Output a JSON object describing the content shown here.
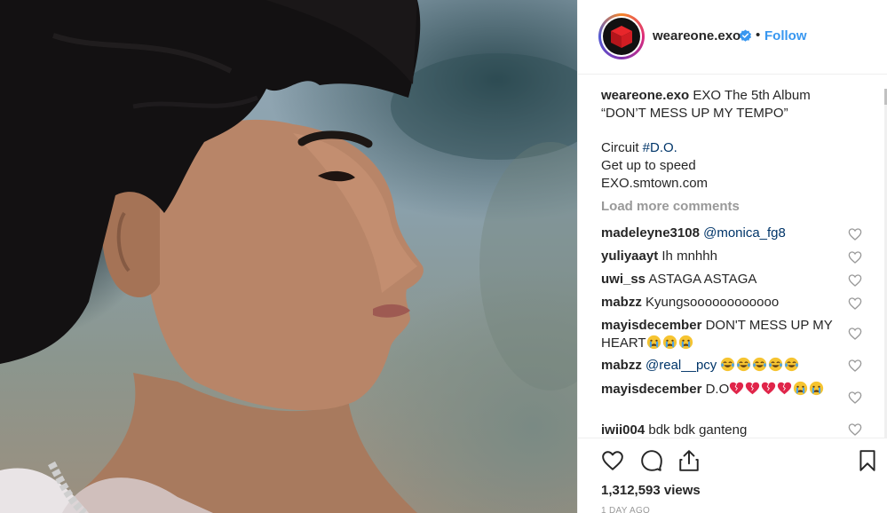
{
  "post": {
    "username": "weareone.exo",
    "follow_label": "Follow",
    "separator": "•",
    "caption": {
      "username": "weareone.exo",
      "line1": "EXO The 5th Album",
      "line2": "“DON’T MESS UP MY TEMPO”",
      "line3_prefix": "Circuit ",
      "line3_tag": "#D.O.",
      "line4": "Get up to speed",
      "line5": "EXO.smtown.com"
    },
    "load_more": "Load more comments",
    "views": "1,312,593 views",
    "time": "1 DAY AGO"
  },
  "comments": [
    {
      "user": "madeleyne3108",
      "mention": "@monica_fg8",
      "text": ""
    },
    {
      "user": "yuliyaayt",
      "text": "Ih mnhhh"
    },
    {
      "user": "uwi_ss",
      "text": "ASTAGA ASTAGA"
    },
    {
      "user": "mabzz",
      "text": "Kyungsoooooooooooo"
    },
    {
      "user": "mayisdecember",
      "text": "DON'T MESS UP MY HEART"
    },
    {
      "user": "mabzz",
      "mention": "@real__pcy",
      "text": ""
    },
    {
      "user": "mayisdecember",
      "text": "D.O"
    },
    {
      "user": "iwii004",
      "text": "bdk bdk ganteng"
    }
  ],
  "icons": {
    "avatar": "red-cube-logo",
    "verified": "verified-badge-icon",
    "like": "heart-outline-icon",
    "comment": "comment-bubble-icon",
    "share": "share-upload-icon",
    "save": "bookmark-icon"
  },
  "colors": {
    "link": "#3897f0",
    "mention": "#003569",
    "muted": "#999999",
    "text": "#262626"
  }
}
